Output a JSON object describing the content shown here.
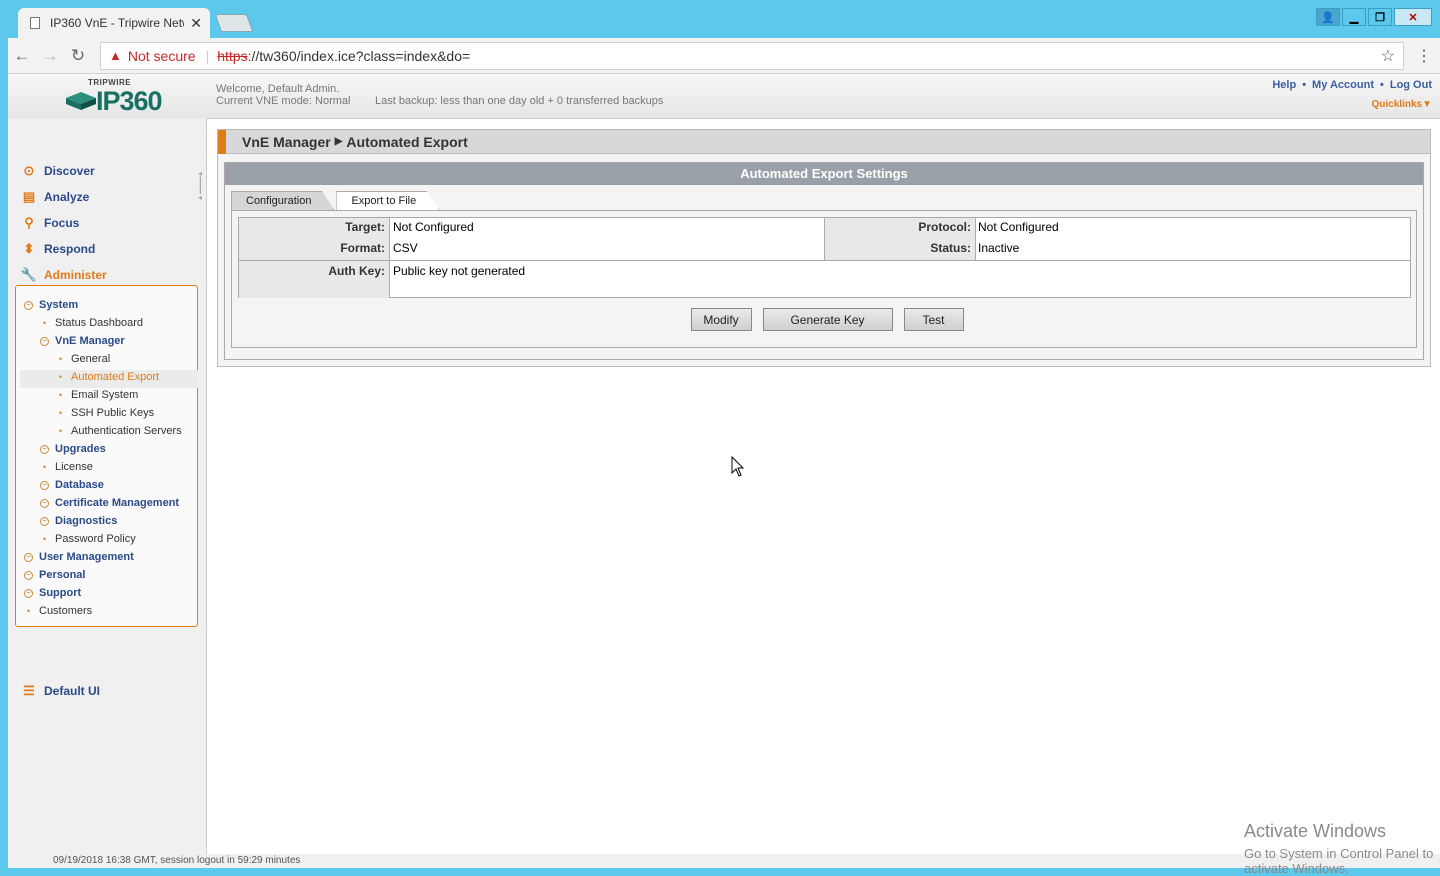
{
  "browser": {
    "tab_title": "IP360 VnE - Tripwire Netw",
    "security_label": "Not secure",
    "url_scheme": "https",
    "url_rest": "://tw360/index.ice?class=index&do="
  },
  "header": {
    "logo_brand": "TRIPWIRE",
    "logo_product": "IP360",
    "welcome": "Welcome, Default Admin.",
    "vne_mode": "Current VNE mode: Normal",
    "backup": "Last backup: less than one day old  + 0 transferred backups",
    "links": [
      "Help",
      "My Account",
      "Log Out"
    ],
    "quicklinks": "Quicklinks▼"
  },
  "nav": {
    "items": [
      {
        "label": "Discover",
        "icon": "discover-icon"
      },
      {
        "label": "Analyze",
        "icon": "analyze-icon"
      },
      {
        "label": "Focus",
        "icon": "search-icon"
      },
      {
        "label": "Respond",
        "icon": "respond-icon"
      },
      {
        "label": "Administer",
        "icon": "wrench-icon"
      }
    ],
    "default_ui": "Default UI"
  },
  "tree": [
    {
      "label": "System",
      "level": 0,
      "type": "group"
    },
    {
      "label": "Status Dashboard",
      "level": 1,
      "type": "leaf"
    },
    {
      "label": "VnE Manager",
      "level": 1,
      "type": "group"
    },
    {
      "label": "General",
      "level": 2,
      "type": "leaf"
    },
    {
      "label": "Automated Export",
      "level": 2,
      "type": "leaf"
    },
    {
      "label": "Email System",
      "level": 2,
      "type": "leaf"
    },
    {
      "label": "SSH Public Keys",
      "level": 2,
      "type": "leaf"
    },
    {
      "label": "Authentication Servers",
      "level": 2,
      "type": "leaf"
    },
    {
      "label": "Upgrades",
      "level": 1,
      "type": "group"
    },
    {
      "label": "License",
      "level": 1,
      "type": "leaf"
    },
    {
      "label": "Database",
      "level": 1,
      "type": "group"
    },
    {
      "label": "Certificate Management",
      "level": 1,
      "type": "group"
    },
    {
      "label": "Diagnostics",
      "level": 1,
      "type": "group"
    },
    {
      "label": "Password Policy",
      "level": 1,
      "type": "leaf"
    },
    {
      "label": "User Management",
      "level": 0,
      "type": "group"
    },
    {
      "label": "Personal",
      "level": 0,
      "type": "group"
    },
    {
      "label": "Support",
      "level": 0,
      "type": "group"
    },
    {
      "label": "Customers",
      "level": 0,
      "type": "leaf"
    }
  ],
  "breadcrumb": {
    "parent": "VnE Manager",
    "current": "Automated Export"
  },
  "settings": {
    "title": "Automated Export Settings",
    "tabs": [
      "Configuration",
      "Export to File"
    ],
    "fields": {
      "target_label": "Target:",
      "target_value": "Not Configured",
      "format_label": "Format:",
      "format_value": "CSV",
      "protocol_label": "Protocol:",
      "protocol_value": "Not Configured",
      "status_label": "Status:",
      "status_value": "Inactive",
      "authkey_label": "Auth Key:",
      "authkey_value": "Public key not generated"
    },
    "buttons": {
      "modify": "Modify",
      "generate_key": "Generate Key",
      "test": "Test"
    }
  },
  "status": "09/19/2018 16:38 GMT, session logout in  59:29 minutes",
  "watermark": {
    "line1": "Activate Windows",
    "line2": "Go to System in Control Panel to activate Windows."
  },
  "colors": {
    "accent": "#e07b1a",
    "nav_text": "#2b4a8a",
    "titlebar": "#5bc8ec"
  }
}
